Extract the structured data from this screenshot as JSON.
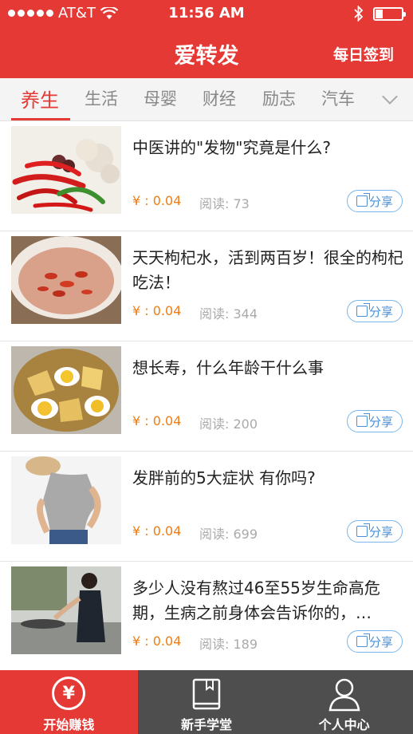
{
  "status_bar": {
    "carrier": "AT&T",
    "time": "11:56 AM",
    "battery_level": 0.25
  },
  "nav": {
    "title": "爱转发",
    "right_action": "每日签到"
  },
  "tabs": [
    {
      "label": "养生",
      "active": true
    },
    {
      "label": "生活",
      "active": false
    },
    {
      "label": "母婴",
      "active": false
    },
    {
      "label": "财经",
      "active": false
    },
    {
      "label": "励志",
      "active": false
    },
    {
      "label": "汽车",
      "active": false
    }
  ],
  "articles": [
    {
      "title": "中医讲的\"发物\"究竟是什么?",
      "price": "¥ : 0.04",
      "reads": "阅读: 73",
      "share": "分享",
      "thumb": "chili-garlic"
    },
    {
      "title": "天天枸杞水，活到两百岁！很全的枸杞吃法！",
      "price": "¥ : 0.04",
      "reads": "阅读: 344",
      "share": "分享",
      "thumb": "goji-soup"
    },
    {
      "title": "想长寿，什么年龄干什么事",
      "price": "¥ : 0.04",
      "reads": "阅读: 200",
      "share": "分享",
      "thumb": "egg-potato-stew"
    },
    {
      "title": "发胖前的5大症状 有你吗?",
      "price": "¥ : 0.04",
      "reads": "阅读: 699",
      "share": "分享",
      "thumb": "woman-waist"
    },
    {
      "title": "多少人没有熬过46至55岁生命高危期，生病之前身体会告诉你的，…",
      "price": "¥ : 0.04",
      "reads": "阅读: 189",
      "share": "分享",
      "thumb": "woman-cooking"
    }
  ],
  "bottom_tabs": [
    {
      "label": "开始赚钱",
      "icon": "yen-icon",
      "active": true
    },
    {
      "label": "新手学堂",
      "icon": "book-icon",
      "active": false
    },
    {
      "label": "个人中心",
      "icon": "person-icon",
      "active": false
    }
  ],
  "colors": {
    "primary": "#e53935",
    "price": "#f07c12",
    "share": "#4a90d9",
    "bottom_inactive": "#4e4e4e"
  }
}
